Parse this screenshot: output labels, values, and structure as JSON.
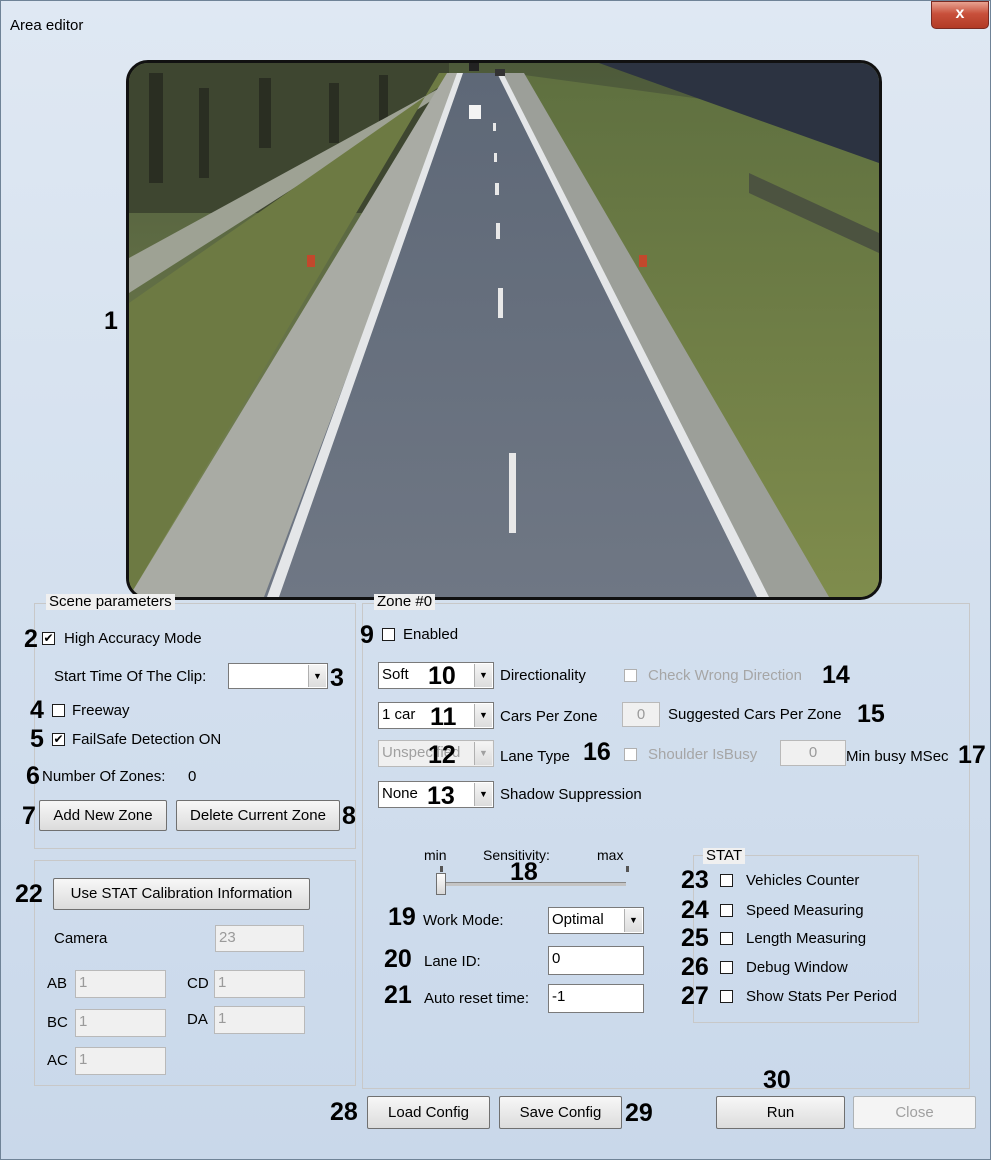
{
  "window": {
    "title": "Area editor",
    "close_glyph": "x"
  },
  "video": {
    "callout": "1"
  },
  "scene": {
    "legend": "Scene parameters",
    "high_accuracy": {
      "num": "2",
      "label": "High Accuracy Mode",
      "checked": true
    },
    "start_time": {
      "label": "Start Time Of The Clip:",
      "value": "",
      "num": "3"
    },
    "freeway": {
      "num": "4",
      "label": "Freeway",
      "checked": false
    },
    "failsafe": {
      "num": "5",
      "label": "FailSafe Detection ON",
      "checked": true
    },
    "zones": {
      "num": "6",
      "label": "Number Of Zones:",
      "value": "0"
    },
    "add_zone": {
      "num": "7",
      "label": "Add New Zone"
    },
    "delete_zone": {
      "num": "8",
      "label": "Delete Current Zone"
    }
  },
  "calib": {
    "num": "22",
    "use_stat": "Use STAT Calibration Information",
    "camera": {
      "label": "Camera",
      "value": "23"
    },
    "ab": {
      "label": "AB",
      "value": "1"
    },
    "bc": {
      "label": "BC",
      "value": "1"
    },
    "ac": {
      "label": "AC",
      "value": "1"
    },
    "cd": {
      "label": "CD",
      "value": "1"
    },
    "da": {
      "label": "DA",
      "value": "1"
    }
  },
  "zone": {
    "legend": "Zone #0",
    "enabled": {
      "num": "9",
      "label": "Enabled",
      "checked": false
    },
    "directionality": {
      "value": "Soft",
      "num": "10",
      "label": "Directionality"
    },
    "wrong_dir": {
      "label": "Check Wrong Direction",
      "num": "14"
    },
    "cars": {
      "value": "1 car",
      "num": "11",
      "label": "Cars Per Zone"
    },
    "suggested": {
      "value": "0",
      "label": "Suggested Cars Per Zone",
      "num": "15"
    },
    "lane_type": {
      "value": "Unspecified",
      "num": "12",
      "label": "Lane Type"
    },
    "shoulder": {
      "num": "16",
      "label": "Shoulder IsBusy",
      "value": "0",
      "min_busy": "Min busy MSec",
      "num2": "17"
    },
    "shadow": {
      "value": "None",
      "num": "13",
      "label": "Shadow Suppression"
    },
    "sensitivity": {
      "min": "min",
      "label": "Sensitivity:",
      "max": "max",
      "num": "18",
      "level": 0.0
    },
    "work_mode": {
      "num": "19",
      "label": "Work Mode:",
      "value": "Optimal"
    },
    "lane_id": {
      "num": "20",
      "label": "Lane ID:",
      "value": "0"
    },
    "auto_reset": {
      "num": "21",
      "label": "Auto reset time:",
      "value": "-1"
    },
    "stat": {
      "legend": "STAT",
      "items": [
        {
          "num": "23",
          "label": "Vehicles Counter"
        },
        {
          "num": "24",
          "label": "Speed Measuring"
        },
        {
          "num": "25",
          "label": "Length Measuring"
        },
        {
          "num": "26",
          "label": "Debug Window"
        },
        {
          "num": "27",
          "label": "Show Stats Per Period"
        }
      ]
    }
  },
  "footer": {
    "load": {
      "num": "28",
      "label": "Load Config"
    },
    "save": {
      "num": "29",
      "label": "Save Config"
    },
    "run": {
      "num": "30",
      "label": "Run"
    },
    "close": {
      "label": "Close"
    }
  },
  "icons": {
    "check": "checkmark-glyph",
    "dropdown": "triangle-down-glyph"
  }
}
